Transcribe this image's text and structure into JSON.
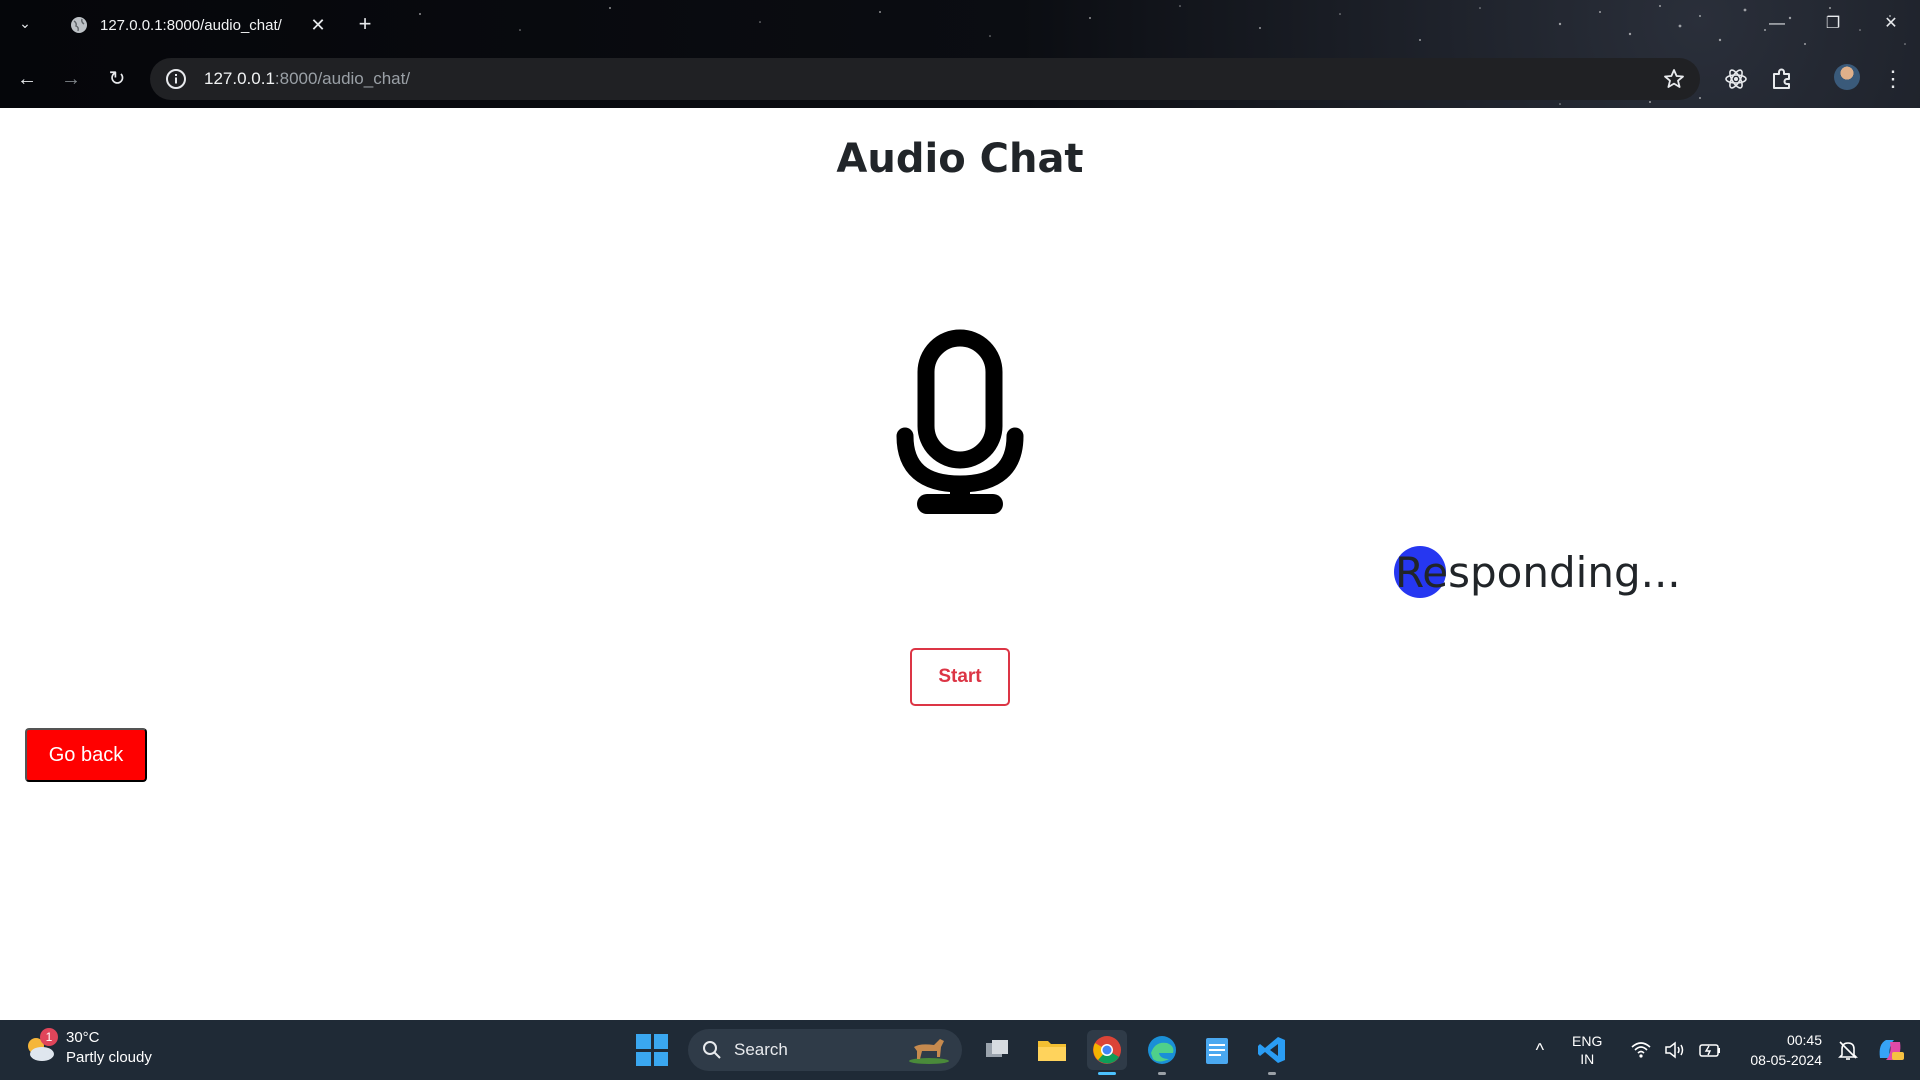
{
  "browser": {
    "tab_title": "127.0.0.1:8000/audio_chat/",
    "url_host": "127.0.0.1",
    "url_path": ":8000/audio_chat/"
  },
  "page": {
    "title": "Audio Chat",
    "status_text": "Responding...",
    "start_label": "Start",
    "go_back_label": "Go back",
    "accent_color": "#dc3545",
    "go_back_color": "#ff0000",
    "indicator_color": "#1a2cf0"
  },
  "taskbar": {
    "weather_temp": "30°C",
    "weather_desc": "Partly cloudy",
    "weather_badge": "1",
    "search_label": "Search",
    "lang_top": "ENG",
    "lang_bottom": "IN",
    "time": "00:45",
    "date": "08-05-2024"
  }
}
